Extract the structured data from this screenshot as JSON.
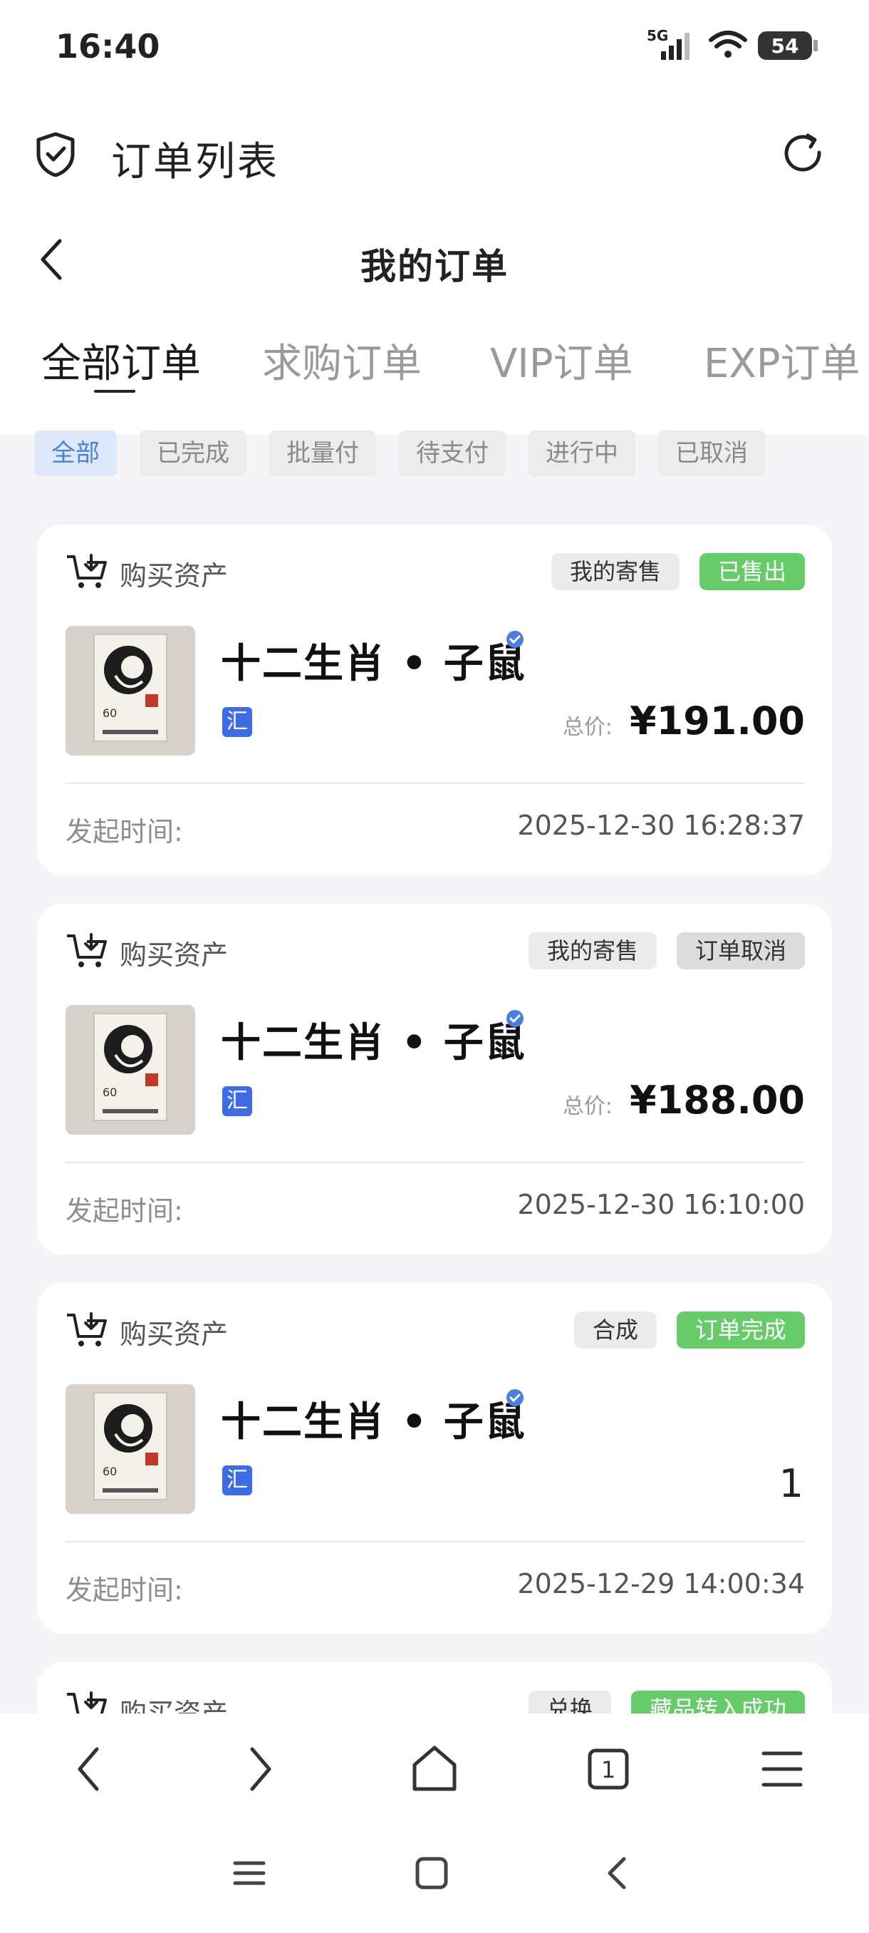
{
  "status_bar": {
    "time": "16:40",
    "network": "5G",
    "battery": "54"
  },
  "app_header": {
    "title": "订单列表"
  },
  "nav": {
    "title": "我的订单"
  },
  "tabs": [
    {
      "label": "全部订单",
      "active": true
    },
    {
      "label": "求购订单",
      "active": false
    },
    {
      "label": "VIP订单",
      "active": false
    },
    {
      "label": "EXP订单",
      "active": false
    }
  ],
  "filters": [
    {
      "label": "全部",
      "active": true
    },
    {
      "label": "已完成",
      "active": false
    },
    {
      "label": "批量付",
      "active": false
    },
    {
      "label": "待支付",
      "active": false
    },
    {
      "label": "进行中",
      "active": false
    },
    {
      "label": "已取消",
      "active": false
    }
  ],
  "orders": [
    {
      "type_label": "购买资产",
      "badges": [
        "我的寄售",
        "已售出"
      ],
      "item_name": "十二生肖 • 子鼠",
      "tag": "汇",
      "price_label": "总价:",
      "price": "¥191.00",
      "time_label": "发起时间:",
      "time": "2025-12-30 16:28:37"
    },
    {
      "type_label": "购买资产",
      "badges": [
        "我的寄售",
        "订单取消"
      ],
      "item_name": "十二生肖 • 子鼠",
      "tag": "汇",
      "price_label": "总价:",
      "price": "¥188.00",
      "time_label": "发起时间:",
      "time": "2025-12-30 16:10:00"
    },
    {
      "type_label": "购买资产",
      "badges": [
        "合成",
        "订单完成"
      ],
      "item_name": "十二生肖 • 子鼠",
      "tag": "汇",
      "quantity": "1",
      "time_label": "发起时间:",
      "time": "2025-12-29 14:00:34"
    },
    {
      "type_label": "购买资产",
      "badges": [
        "兑换",
        "藏品转入成功"
      ]
    }
  ],
  "browser_nav": {
    "tab_count": "1"
  },
  "colors": {
    "accent_blue": "#3e6ce6",
    "success_green": "#66cc6a",
    "chip_active_bg": "#dde8fb"
  }
}
